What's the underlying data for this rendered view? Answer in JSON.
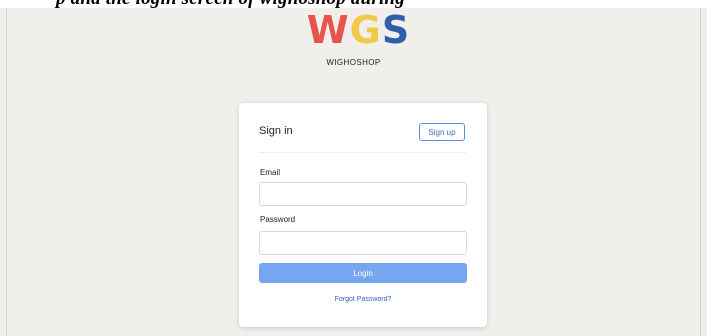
{
  "caption": "p and the login screen of wighoshop during",
  "brand": {
    "logo_letters": [
      "W",
      "G",
      "S"
    ],
    "logo_colors": [
      "#e8544d",
      "#f2c84b",
      "#2f5fab"
    ],
    "name": "WIGHOSHOP"
  },
  "signin_form": {
    "title": "Sign in",
    "signup_label": "Sign up",
    "email_label": "Email",
    "email_value": "",
    "password_label": "Password",
    "password_value": "",
    "login_label": "Login",
    "forgot_label": "Forgot Password?",
    "accent_color": "#76a6ef"
  }
}
